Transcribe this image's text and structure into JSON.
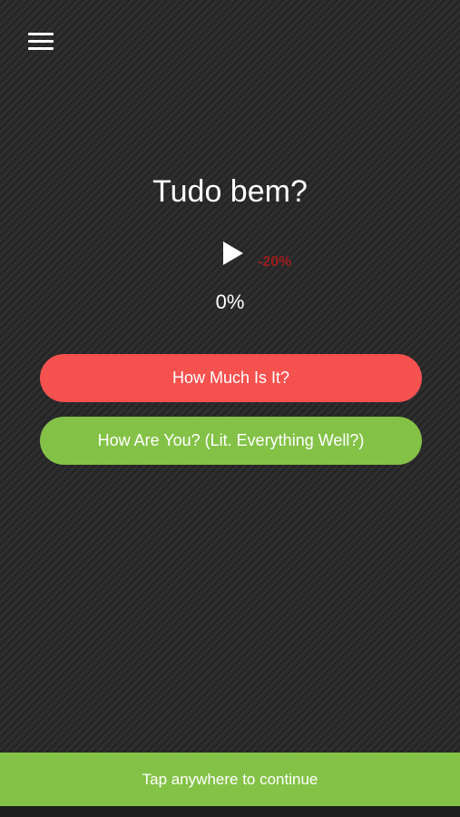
{
  "header": {
    "menu_icon": "hamburger-menu-icon"
  },
  "quiz": {
    "phrase": "Tudo bem?",
    "play_icon": "play-icon",
    "discount": "-20%",
    "progress_label": "0%",
    "progress_value": 0
  },
  "answers": [
    {
      "label": "How Much Is It?",
      "color": "#f4514f"
    },
    {
      "label": "How Are You? (Lit. Everything Well?)",
      "color": "#84c247"
    }
  ],
  "footer": {
    "continue_label": "Tap anywhere to continue",
    "color": "#84c247"
  },
  "colors": {
    "background": "#2b2b2c",
    "discount": "#9e1d1d"
  }
}
